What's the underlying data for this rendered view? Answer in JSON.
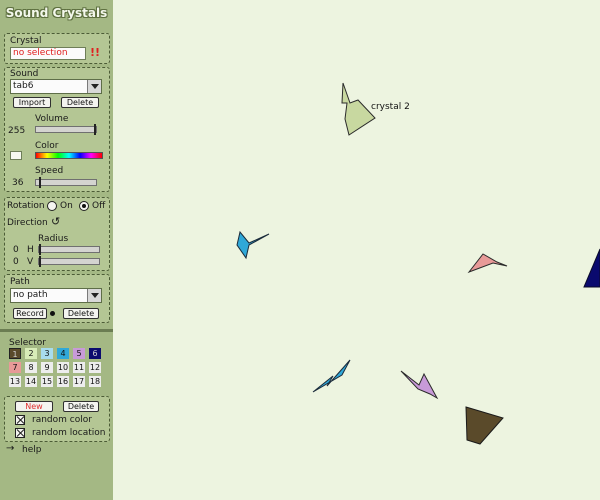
{
  "app": {
    "title": "Sound Crystals"
  },
  "crystal_panel": {
    "label": "Crystal",
    "selection": "no selection",
    "warning": "!!"
  },
  "sound_panel": {
    "label": "Sound",
    "selected_sound": "tab6",
    "import_label": "Import",
    "delete_label": "Delete",
    "volume_label": "Volume",
    "volume_value": "255",
    "volume_fraction": 1.0,
    "color_label": "Color",
    "speed_label": "Speed",
    "speed_value": "36",
    "speed_fraction": 0.05
  },
  "rotation_panel": {
    "rotation_label": "Rotation",
    "on_label": "On",
    "off_label": "Off",
    "selected": "Off",
    "direction_label": "Direction",
    "direction_icon": "↺",
    "radius_label": "Radius",
    "h_label": "H",
    "h_value": "0",
    "v_label": "V",
    "v_value": "0"
  },
  "path_panel": {
    "label": "Path",
    "selected_path": "no path",
    "record_label": "Record",
    "delete_label": "Delete"
  },
  "selector": {
    "label": "Selector",
    "cells": [
      {
        "n": "1",
        "color": "#5a4a2a"
      },
      {
        "n": "2",
        "color": "#d8ecb8"
      },
      {
        "n": "3",
        "color": "#a8dcee"
      },
      {
        "n": "4",
        "color": "#30a8d8"
      },
      {
        "n": "5",
        "color": "#c89ad8"
      },
      {
        "n": "6",
        "color": "#0a0a6e"
      },
      {
        "n": "7",
        "color": "#e89a98"
      },
      {
        "n": "8",
        "color": "#ededed"
      },
      {
        "n": "9",
        "color": "#ededed"
      },
      {
        "n": "10",
        "color": "#ededed"
      },
      {
        "n": "11",
        "color": "#ededed"
      },
      {
        "n": "12",
        "color": "#ededed"
      },
      {
        "n": "13",
        "color": "#ededed"
      },
      {
        "n": "14",
        "color": "#ededed"
      },
      {
        "n": "15",
        "color": "#ededed"
      },
      {
        "n": "16",
        "color": "#ededed"
      },
      {
        "n": "17",
        "color": "#ededed"
      },
      {
        "n": "18",
        "color": "#ededed"
      }
    ]
  },
  "new_panel": {
    "new_label": "New",
    "delete_label": "Delete",
    "random_color_label": "random color",
    "random_location_label": "random location"
  },
  "help": {
    "arrow": "→",
    "label": "help"
  },
  "canvas": {
    "crystal_label": "crystal 2"
  },
  "colors": {
    "sidebar": "#a4b884",
    "canvas": "#edf4e0",
    "new_button_text": "#e03030",
    "crystal_green": "#c8d8a0",
    "crystal_blue": "#30a8d8",
    "crystal_pink": "#e89a98",
    "crystal_brown": "#5a4a2a",
    "crystal_navy": "#0a0a6e"
  }
}
